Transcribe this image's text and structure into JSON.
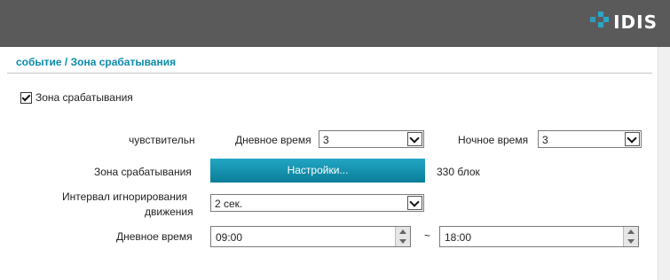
{
  "brand": {
    "logo_text": "IDIS",
    "accent": "#29a7c9"
  },
  "breadcrumb": "событие / Зона срабатывания",
  "motion_zone": {
    "enabled_label": "Зона срабатывания",
    "enabled": true
  },
  "sensitivity": {
    "label": "чувствительн",
    "day_label": "Дневное время",
    "day_value": "3",
    "night_label": "Ночное время",
    "night_value": "3"
  },
  "zone": {
    "label": "Зона срабатывания",
    "button_label": "Настройки...",
    "blocks": "330 блок"
  },
  "ignore_interval": {
    "label_line1": "Интервал игнорирования",
    "label_line2": "движения",
    "value": "2 сек."
  },
  "daytime": {
    "label": "Дневное время",
    "start": "09:00",
    "separator": "~",
    "end": "18:00"
  },
  "icons": {
    "dropdown": "chevron-down-icon",
    "spin_up": "arrow-up-icon",
    "spin_down": "arrow-down-icon",
    "checkbox": "checkmark-icon"
  }
}
